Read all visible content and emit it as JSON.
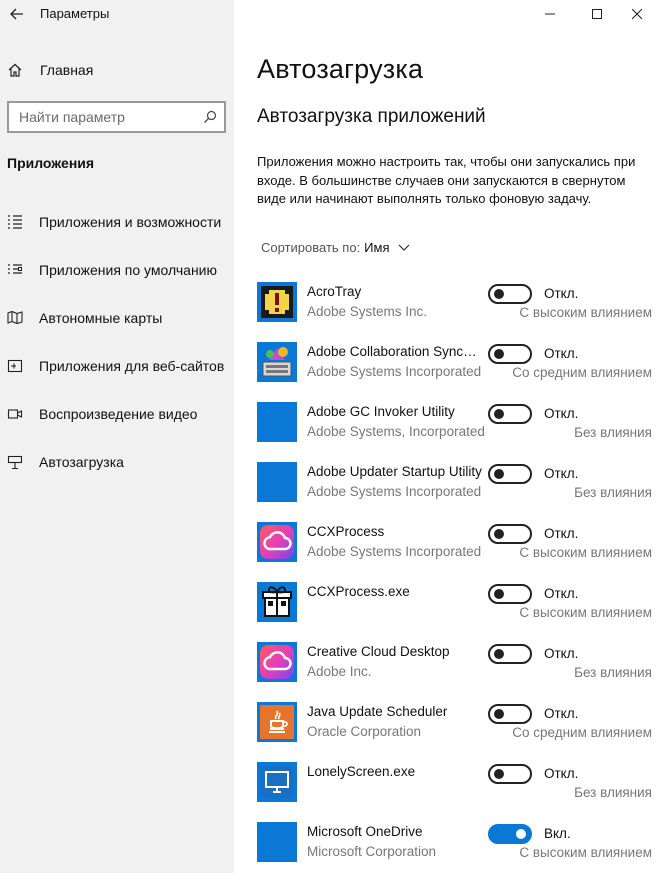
{
  "window": {
    "title": "Параметры",
    "controls": [
      "minimize",
      "maximize",
      "close"
    ]
  },
  "sidebar": {
    "home_label": "Главная",
    "search_placeholder": "Найти параметр",
    "section_title": "Приложения",
    "items": [
      {
        "label": "Приложения и возможности",
        "icon": "apps-list-icon"
      },
      {
        "label": "Приложения по умолчанию",
        "icon": "default-apps-icon"
      },
      {
        "label": "Автономные карты",
        "icon": "map-icon"
      },
      {
        "label": "Приложения для веб-сайтов",
        "icon": "web-apps-icon"
      },
      {
        "label": "Воспроизведение видео",
        "icon": "video-icon"
      },
      {
        "label": "Автозагрузка",
        "icon": "startup-icon"
      }
    ]
  },
  "main": {
    "title": "Автозагрузка",
    "subtitle": "Автозагрузка приложений",
    "description": "Приложения можно настроить так, чтобы они запускались при входе. В большинстве случаев они запускаются в свернутом виде или начинают выполнять только фоновую задачу.",
    "sort_label": "Сортировать по:",
    "sort_value": "Имя",
    "apps": [
      {
        "name": "AcroTray",
        "publisher": "Adobe Systems Inc.",
        "enabled": false,
        "state": "Откл.",
        "impact": "С высоким влиянием",
        "icon": "acrotray-icon",
        "icon_color": "#0a78d4"
      },
      {
        "name": "Adobe Collaboration Synchronizer",
        "publisher": "Adobe Systems Incorporated",
        "enabled": false,
        "state": "Откл.",
        "impact": "Со средним влиянием",
        "icon": "adobe-collab-sync-icon",
        "icon_color": "#0a78d4"
      },
      {
        "name": "Adobe GC Invoker Utility",
        "publisher": "Adobe Systems, Incorporated",
        "enabled": false,
        "state": "Откл.",
        "impact": "Без влияния",
        "icon": "blank-app-icon",
        "icon_color": "#0a78d4"
      },
      {
        "name": "Adobe Updater Startup Utility",
        "publisher": "Adobe Systems Incorporated",
        "enabled": false,
        "state": "Откл.",
        "impact": "Без влияния",
        "icon": "blank-app-icon",
        "icon_color": "#0a78d4"
      },
      {
        "name": "CCXProcess",
        "publisher": "Adobe Systems Incorporated",
        "enabled": false,
        "state": "Откл.",
        "impact": "С высоким влиянием",
        "icon": "creative-cloud-icon",
        "icon_color": "#0a78d4"
      },
      {
        "name": "CCXProcess.exe",
        "publisher": "",
        "enabled": false,
        "state": "Откл.",
        "impact": "С высоким влиянием",
        "icon": "gift-box-icon",
        "icon_color": "#0a78d4"
      },
      {
        "name": "Creative Cloud Desktop",
        "publisher": "Adobe Inc.",
        "enabled": false,
        "state": "Откл.",
        "impact": "Без влияния",
        "icon": "creative-cloud-icon",
        "icon_color": "#0a78d4"
      },
      {
        "name": "Java Update Scheduler",
        "publisher": "Oracle Corporation",
        "enabled": false,
        "state": "Откл.",
        "impact": "Со средним влиянием",
        "icon": "java-icon",
        "icon_color": "#0a78d4"
      },
      {
        "name": "LonelyScreen.exe",
        "publisher": "",
        "enabled": false,
        "state": "Откл.",
        "impact": "Без влияния",
        "icon": "monitor-icon",
        "icon_color": "#0a78d4"
      },
      {
        "name": "Microsoft OneDrive",
        "publisher": "Microsoft Corporation",
        "enabled": true,
        "state": "Вкл.",
        "impact": "С высоким влиянием",
        "icon": "onedrive-icon",
        "icon_color": "#0a78d4"
      }
    ]
  },
  "colors": {
    "accent": "#0a78d4",
    "sidebar_bg": "#f1f1f1"
  }
}
